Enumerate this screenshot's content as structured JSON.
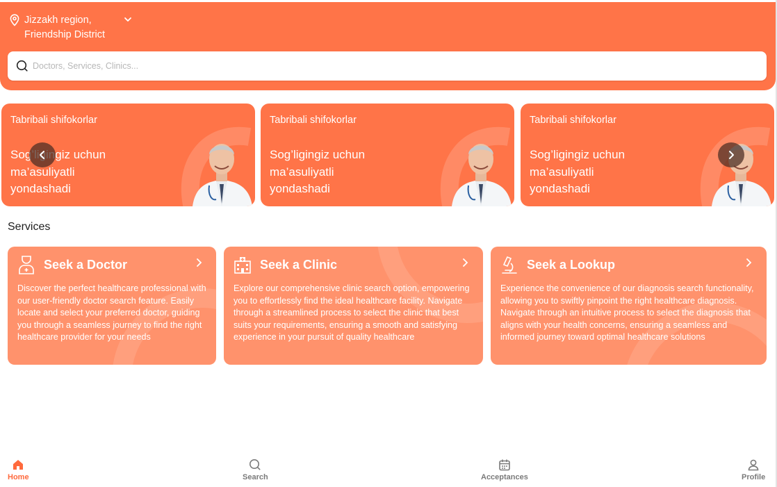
{
  "header": {
    "location_line1": "Jizzakh region,",
    "location_line2": "Friendship District",
    "search_placeholder": "Doctors, Services, Clinics..."
  },
  "banners": [
    {
      "title": "Tabribali shifokorlar",
      "text": "Sog’ligingiz uchun ma’asuliyatli yondashadi"
    },
    {
      "title": "Tabribali shifokorlar",
      "text": "Sog’ligingiz uchun ma’asuliyatli yondashadi"
    },
    {
      "title": "Tabribali shifokorlar",
      "text": "Sog’ligingiz uchun ma’asuliyatli yondashadi"
    }
  ],
  "services": {
    "title": "Services",
    "cards": [
      {
        "title": "Seek a Doctor",
        "icon": "doctor-icon",
        "description": "Discover the perfect healthcare professional with our user-friendly doctor search feature. Easily locate and select your preferred doctor, guiding you through a seamless journey to find the right healthcare provider for your needs"
      },
      {
        "title": "Seek a Clinic",
        "icon": "hospital-icon",
        "description": "Explore our comprehensive clinic search option, empowering you to effortlessly find the ideal healthcare facility. Navigate through a streamlined process to select the clinic that best suits your requirements, ensuring a smooth and satisfying experience in your pursuit of quality healthcare"
      },
      {
        "title": "Seek a Lookup",
        "icon": "microscope-icon",
        "description": "Experience the convenience of our diagnosis search functionality, allowing you to swiftly pinpoint the right healthcare diagnosis. Navigate through an intuitive process to select the diagnosis that aligns with your health concerns, ensuring a seamless and informed journey toward optimal healthcare solutions"
      }
    ]
  },
  "bottom_nav": [
    {
      "label": "Home",
      "icon": "home-icon",
      "active": true
    },
    {
      "label": "Search",
      "icon": "search-icon",
      "active": false
    },
    {
      "label": "Acceptances",
      "icon": "calendar-icon",
      "active": false
    },
    {
      "label": "Profile",
      "icon": "profile-icon",
      "active": false
    }
  ],
  "colors": {
    "accent": "#ff7448",
    "card": "#ff926c",
    "active_nav": "#ff6a3d",
    "inactive_nav": "#7a7a7a"
  }
}
